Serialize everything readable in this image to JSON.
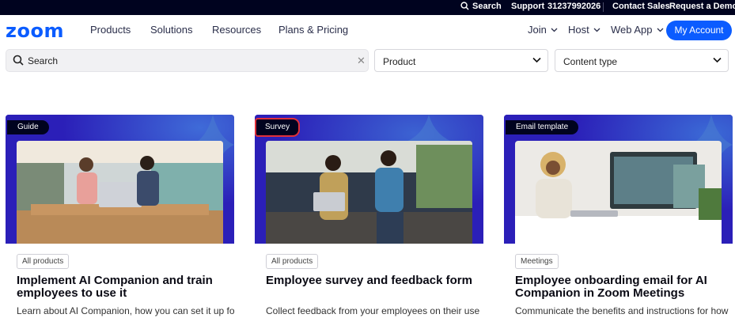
{
  "topbar": {
    "search_label": "Search",
    "support_label": "Support",
    "phone": "31237992026",
    "contact_sales": "Contact Sales",
    "request_demo": "Request a Demo"
  },
  "nav": {
    "logo": "zoom",
    "links": [
      "Products",
      "Solutions",
      "Resources",
      "Plans & Pricing"
    ],
    "right_links": [
      "Join",
      "Host",
      "Web App"
    ],
    "account_button": "My Account"
  },
  "filters": {
    "search_placeholder": "Search",
    "product_select": "Product",
    "content_type_select": "Content type"
  },
  "cards": [
    {
      "badge": "Guide",
      "tag": "All products",
      "title": "Implement AI Companion and train employees to use it",
      "description": "Learn about AI Companion, how you can set it up for"
    },
    {
      "badge": "Survey",
      "tag": "All products",
      "title": "Employee survey and feedback form",
      "description": "Collect feedback from your employees on their use"
    },
    {
      "badge": "Email template",
      "tag": "Meetings",
      "title": "Employee onboarding email for AI Companion in Zoom Meetings",
      "description": "Communicate the benefits and instructions for how"
    }
  ],
  "colors": {
    "brand_blue": "#0b5cff",
    "topbar_bg": "#00031f",
    "card_media_bg": "#2b1fb8",
    "highlight_outline": "#e0303a"
  }
}
